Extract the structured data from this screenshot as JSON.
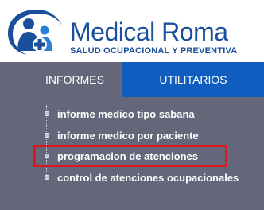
{
  "brand": {
    "name": "Medical Roma",
    "tagline": "SALUD OCUPACIONAL Y PREVENTIVA",
    "primary_color": "#1a4f9c"
  },
  "tabs": [
    {
      "label": "INFORMES",
      "active": true
    },
    {
      "label": "UTILITARIOS",
      "active": false
    }
  ],
  "menu_items": [
    {
      "label": "informe medico tipo sabana"
    },
    {
      "label": "informe medico por paciente"
    },
    {
      "label": "programacion de atenciones",
      "highlighted": true
    },
    {
      "label": "control de atenciones ocupacionales"
    }
  ],
  "colors": {
    "menu_bg": "#636779",
    "tab_active_bg": "#0f5dbf",
    "highlight_border": "#e0161f"
  }
}
